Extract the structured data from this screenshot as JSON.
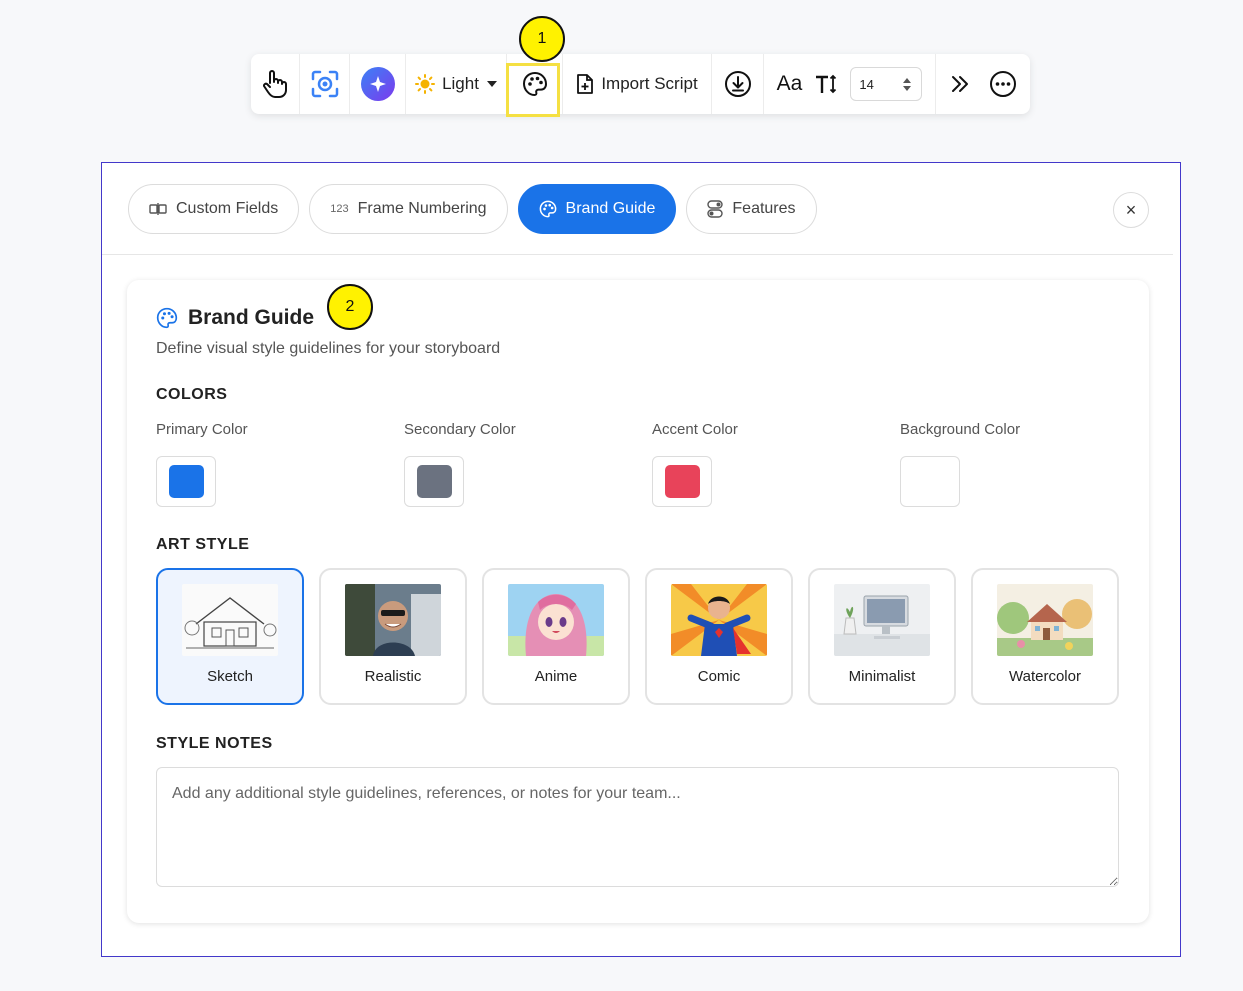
{
  "toolbar": {
    "theme_label": "Light",
    "import_label": "Import Script",
    "font_label": "Aa",
    "font_size": "14",
    "icons": [
      "hand-pointer-icon",
      "screen-capture-icon",
      "ai-sparkle-icon",
      "sun-icon",
      "palette-icon",
      "import-file-icon",
      "download-icon",
      "text-size-icon",
      "double-chevron-right-icon",
      "more-options-icon"
    ]
  },
  "markers": [
    "1",
    "2"
  ],
  "tabs": [
    {
      "label": "Custom Fields",
      "icon": "custom-fields-icon"
    },
    {
      "label": "Frame Numbering",
      "prefix": "123"
    },
    {
      "label": "Brand Guide",
      "icon": "palette-icon",
      "active": true
    },
    {
      "label": "Features",
      "icon": "toggle-icon"
    }
  ],
  "close_symbol": "×",
  "brand_guide": {
    "title": "Brand Guide",
    "subtitle": "Define visual style guidelines for your storyboard",
    "colors_heading": "COLORS",
    "colors": [
      {
        "label": "Primary Color",
        "value": "#1a73e8"
      },
      {
        "label": "Secondary Color",
        "value": "#6b7280"
      },
      {
        "label": "Accent Color",
        "value": "#e8435a"
      },
      {
        "label": "Background Color",
        "value": "#ffffff"
      }
    ],
    "art_style_heading": "ART STYLE",
    "art_styles": [
      {
        "name": "Sketch",
        "selected": true
      },
      {
        "name": "Realistic",
        "selected": false
      },
      {
        "name": "Anime",
        "selected": false
      },
      {
        "name": "Comic",
        "selected": false
      },
      {
        "name": "Minimalist",
        "selected": false
      },
      {
        "name": "Watercolor",
        "selected": false
      }
    ],
    "style_notes_heading": "STYLE NOTES",
    "notes_placeholder": "Add any additional style guidelines, references, or notes for your team..."
  },
  "accent_color": "#1a73e8",
  "highlight_color": "#f5e042"
}
